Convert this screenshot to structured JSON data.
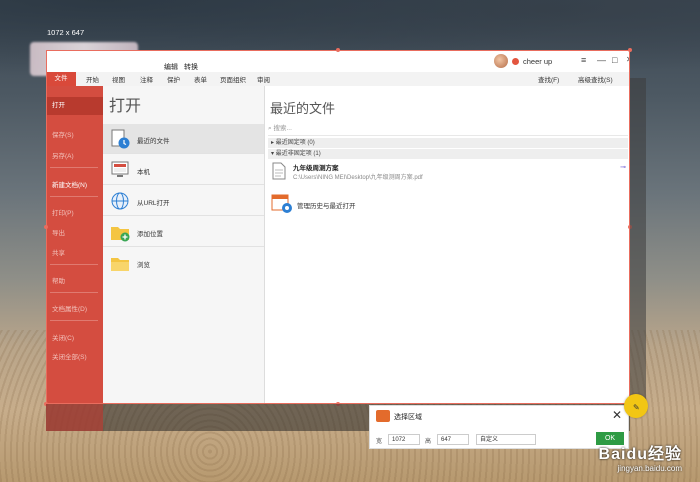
{
  "overlay": {
    "dimensions_text": "1072 x 647"
  },
  "window": {
    "title_left": [
      "编辑",
      "转换"
    ],
    "user_name": "cheer up",
    "controls": [
      "≡",
      "—",
      "□",
      "✕"
    ]
  },
  "ribbon": {
    "file_tab": "文件",
    "tabs": [
      "开始",
      "视图",
      "注释",
      "保护",
      "表单",
      "页面组织",
      "审阅"
    ],
    "right_items": [
      "查找(F)",
      "高级查找(S)"
    ]
  },
  "nav": {
    "active": "打开",
    "items": [
      "保存(S)",
      "另存(A)",
      "新建文档(N)",
      "打印(P)",
      "导出",
      "共享",
      "帮助",
      "文档属性(D)",
      "关闭(C)",
      "关闭全部(S)"
    ]
  },
  "middle": {
    "title": "打开",
    "options": [
      "最近的文件",
      "本机",
      "从URL打开",
      "添加位置",
      "浏览"
    ]
  },
  "recent": {
    "title": "最近的文件",
    "search_placeholder": "搜索...",
    "group_pinned": "最近固定项 (0)",
    "group_unpinned": "最近非固定项 (1)",
    "file_name": "九年级周测方案",
    "file_path": "C:\\Users\\NING MEI\\Desktop\\九年级测周方案.pdf",
    "manage_label": "管理历史与最近打开"
  },
  "select_panel": {
    "title": "选择区域",
    "width_label": "宽",
    "width_value": "1072",
    "height_label": "高",
    "height_value": "647",
    "mode_value": "自定义",
    "ok_label": "OK"
  },
  "watermark": {
    "brand": "Baidu经验",
    "url": "jingyan.baidu.com"
  },
  "colors": {
    "accent_red": "#d44d40",
    "ok_green": "#2e9b44",
    "pen_yellow": "#f2c614"
  }
}
